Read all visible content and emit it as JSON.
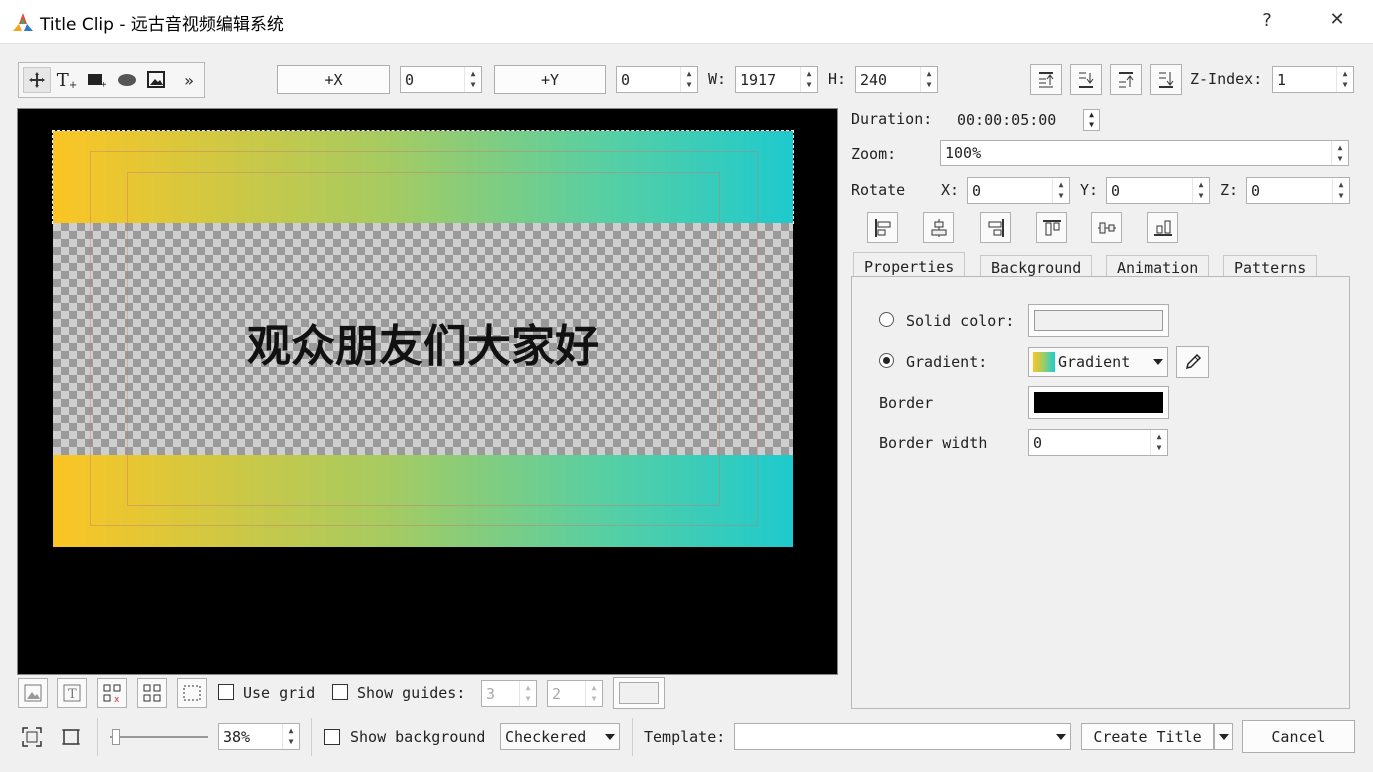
{
  "window": {
    "title": "Title Clip - 远古音视频编辑系统",
    "help": "?",
    "close": "✕"
  },
  "toolbar": {
    "tools": [
      "move-tool",
      "text-tool",
      "rect-tool",
      "ellipse-tool",
      "image-tool",
      "more-tool"
    ],
    "more_glyph": "»",
    "plus_x": "+X",
    "x_value": "0",
    "plus_y": "+Y",
    "y_value": "0",
    "w_label": "W:",
    "w_value": "1917",
    "h_label": "H:",
    "h_value": "240",
    "zindex_label": "Z-Index:",
    "zindex_value": "1"
  },
  "canvas": {
    "text": "观众朋友们大家好"
  },
  "side": {
    "duration_label": "Duration:",
    "duration_value": "00:00:05:00",
    "zoom_label": "Zoom:",
    "zoom_value": "100%",
    "rotate_label": "Rotate",
    "x_label": "X:",
    "x_value": "0",
    "y_label": "Y:",
    "y_value": "0",
    "z_label": "Z:",
    "z_value": "0"
  },
  "tabs": [
    "Properties",
    "Background",
    "Animation",
    "Patterns"
  ],
  "properties": {
    "solid_label": "Solid color:",
    "gradient_label": "Gradient:",
    "gradient_value": "Gradient",
    "border_label": "Border",
    "border_width_label": "Border width",
    "border_width_value": "0",
    "border_color": "#000000"
  },
  "canvas_tools": {
    "use_grid": "Use grid",
    "show_guides": "Show guides:",
    "guide_a": "3",
    "guide_b": "2"
  },
  "bottom": {
    "zoom_value": "38%",
    "show_background": "Show background",
    "background_mode": "Checkered",
    "template_label": "Template:",
    "template_value": "",
    "create_title": "Create Title",
    "cancel": "Cancel"
  },
  "colors": {
    "gradient_start": "#fbc524",
    "gradient_end": "#1ecacd"
  }
}
